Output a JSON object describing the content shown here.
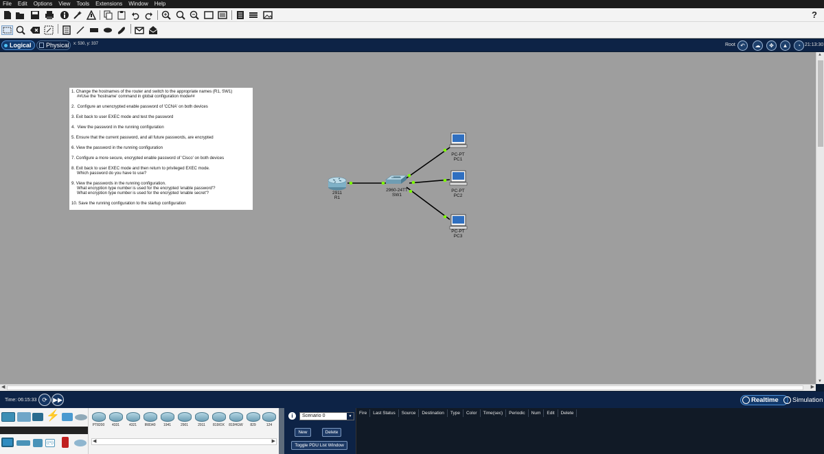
{
  "menu": [
    "File",
    "Edit",
    "Options",
    "View",
    "Tools",
    "Extensions",
    "Window",
    "Help"
  ],
  "toolbar": {
    "icons": [
      "new-icon",
      "open-icon",
      "save-icon",
      "print-icon",
      "info-icon",
      "wizard-icon",
      "network-icon",
      "copy-icon",
      "paste-icon",
      "undo-icon",
      "redo-icon",
      "zoom-in-icon",
      "zoom-reset-icon",
      "zoom-out-icon",
      "drawing-palette-icon",
      "custom-device-icon",
      "cluster-icon",
      "viewport-icon",
      "image-icon"
    ],
    "help": "?"
  },
  "tools": [
    "select-icon",
    "inspect-icon",
    "delete-icon",
    "resize-icon",
    "note-icon",
    "line-icon",
    "rectangle-icon",
    "ellipse-icon",
    "freeform-icon",
    "simple-pdu-icon",
    "complex-pdu-icon"
  ],
  "viewbar": {
    "logical": "Logical",
    "physical": "Physical",
    "coords": "x: 530, y: 337",
    "root": "Root",
    "time": "21:13:30"
  },
  "note": {
    "items": [
      {
        "line1": "1. Change the hostnames of the router and switch to the appropriate names (R1, SW1)",
        "line2": "##Use the 'hostname' command in global configuration mode##"
      },
      {
        "line1": "2.  Configure an unencrypted enable password of 'CCNA' on both devices",
        "line2": ""
      },
      {
        "line1": "3. Exit back to user EXEC mode and test the password",
        "line2": ""
      },
      {
        "line1": "4.  View the password in the running configuration",
        "line2": ""
      },
      {
        "line1": "5. Ensure that the current password, and all future passwords, are encrypted",
        "line2": ""
      },
      {
        "line1": "6. View the password in the running configuration",
        "line2": ""
      },
      {
        "line1": "7. Configure a more secure, encrypted enable password of 'Cisco' on both devices",
        "line2": ""
      },
      {
        "line1": "8. Exit back to user EXEC mode and then return to privileged EXEC mode.",
        "line2": "Which password do you have to use?"
      },
      {
        "line1": "9. View the passwords in the running configuration.",
        "line2": "What encryption type number is used for the encrypted 'enable password'?",
        "line3": "What encryption type number is used for the encrypted 'enable secret'?"
      },
      {
        "line1": "10. Save the running configuration to the startup configuration",
        "line2": ""
      }
    ]
  },
  "devices": {
    "r1": {
      "model": "2911",
      "name": "R1"
    },
    "sw1": {
      "model": "2960-24TT",
      "name": "SW1"
    },
    "pc1": {
      "model": "PC-PT",
      "name": "PC1"
    },
    "pc2": {
      "model": "PC-PT",
      "name": "PC2"
    },
    "pc3": {
      "model": "PC-PT",
      "name": "PC3"
    }
  },
  "link_color": "#7CFC00",
  "timebar": {
    "time": "Time: 06:15:33",
    "realtime": "Realtime",
    "simulation": "Simulation"
  },
  "device_models": [
    "PT8200",
    "4331",
    "4321",
    "IR8340",
    "1941",
    "2901",
    "2911",
    "819IOX",
    "819HGW",
    "829",
    "124"
  ],
  "scenario": {
    "selected": "Scenario 0",
    "new_btn": "New",
    "delete_btn": "Delete",
    "toggle_btn": "Toggle PDU List Window"
  },
  "pdu_columns": [
    "Fire",
    "Last Status",
    "Source",
    "Destination",
    "Type",
    "Color",
    "Time(sec)",
    "Periodic",
    "Num",
    "Edit",
    "Delete"
  ]
}
